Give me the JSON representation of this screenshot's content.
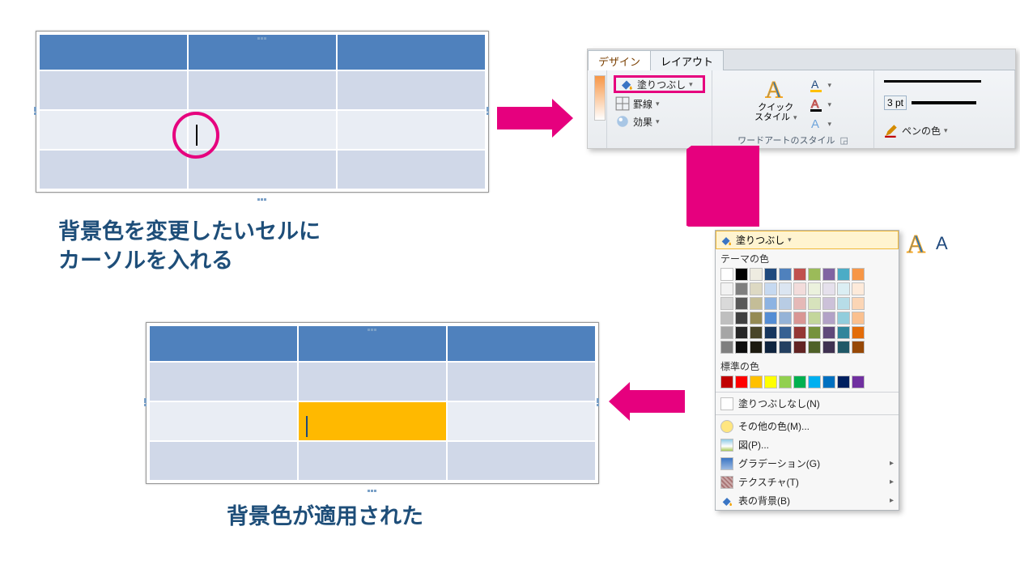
{
  "caption1_line1": "背景色を変更したいセルに",
  "caption1_line2": "カーソルを入れる",
  "caption2": "背景色が適用された",
  "ribbon": {
    "tab_design": "デザイン",
    "tab_layout": "レイアウト",
    "fill_label": "塗りつぶし",
    "border_label": "罫線",
    "effect_label": "効果",
    "quickstyle_line1": "クイック",
    "quickstyle_line2": "スタイル",
    "group_wordart": "ワードアートのスタイル",
    "pen_weight": "3 pt",
    "pen_color": "ペンの色"
  },
  "popup": {
    "button_label": "塗りつぶし",
    "theme_label": "テーマの色",
    "standard_label": "標準の色",
    "no_fill": "塗りつぶしなし(N)",
    "more_colors": "その他の色(M)...",
    "picture": "図(P)...",
    "gradient": "グラデーション(G)",
    "texture": "テクスチャ(T)",
    "table_bg": "表の背景(B)"
  },
  "theme_row_colors": [
    "#ffffff",
    "#000000",
    "#eeece1",
    "#1f497d",
    "#4f81bd",
    "#c0504d",
    "#9bbb59",
    "#8064a2",
    "#4bacc6",
    "#f79646"
  ],
  "theme_shades": [
    [
      "#f2f2f2",
      "#d9d9d9",
      "#bfbfbf",
      "#a6a6a6",
      "#808080"
    ],
    [
      "#7f7f7f",
      "#595959",
      "#404040",
      "#262626",
      "#0d0d0d"
    ],
    [
      "#ddd9c3",
      "#c4bd97",
      "#948a54",
      "#494529",
      "#1d1b10"
    ],
    [
      "#c6d9f0",
      "#8db3e2",
      "#548dd4",
      "#17365d",
      "#0f243e"
    ],
    [
      "#dbe5f1",
      "#b8cce4",
      "#95b3d7",
      "#366092",
      "#244061"
    ],
    [
      "#f2dcdb",
      "#e5b9b7",
      "#d99694",
      "#953734",
      "#632423"
    ],
    [
      "#ebf1dd",
      "#d7e3bc",
      "#c3d69b",
      "#76923c",
      "#4f6128"
    ],
    [
      "#e5e0ec",
      "#ccc1d9",
      "#b2a2c7",
      "#5f497a",
      "#3f3151"
    ],
    [
      "#dbeef3",
      "#b7dde8",
      "#92cddc",
      "#31859b",
      "#205867"
    ],
    [
      "#fdeada",
      "#fbd5b5",
      "#fac08f",
      "#e36c09",
      "#974806"
    ]
  ],
  "standard_colors": [
    "#c00000",
    "#ff0000",
    "#ffc000",
    "#ffff00",
    "#92d050",
    "#00b050",
    "#00b0f0",
    "#0070c0",
    "#002060",
    "#7030a0"
  ]
}
